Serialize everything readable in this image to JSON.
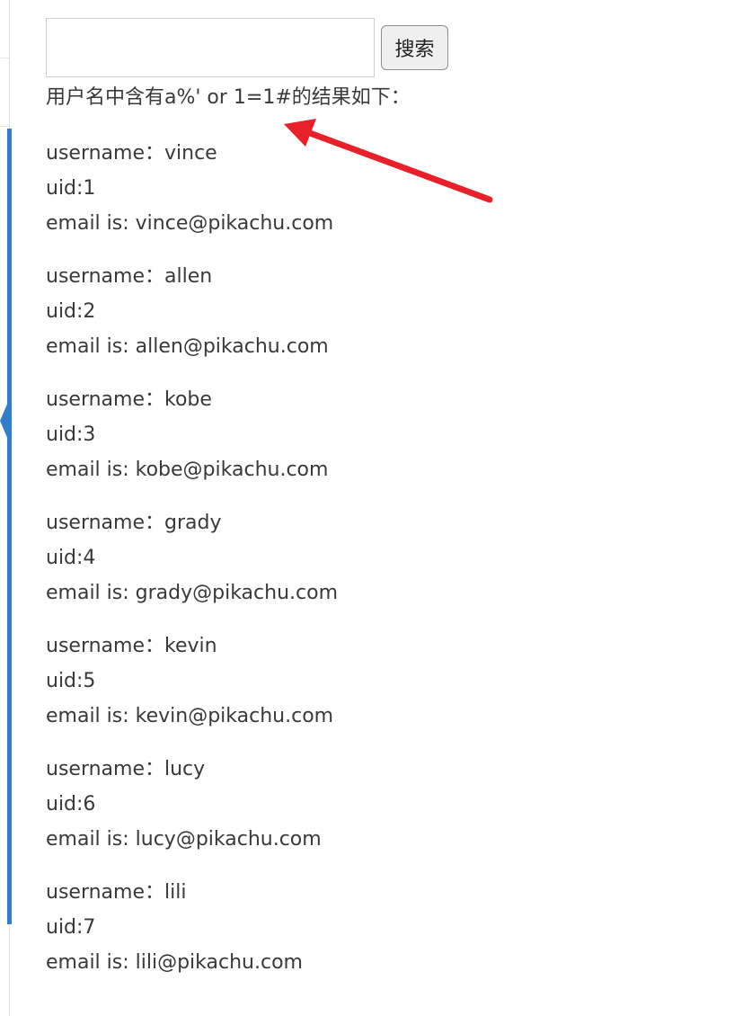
{
  "search": {
    "input_value": "",
    "button_label": "搜索"
  },
  "query": {
    "text": "用户名中含有a%' or 1=1#的结果如下："
  },
  "records": [
    {
      "username": "username：vince",
      "uid": "uid:1",
      "email": "email is: vince@pikachu.com"
    },
    {
      "username": "username：allen",
      "uid": "uid:2",
      "email": "email is: allen@pikachu.com"
    },
    {
      "username": "username：kobe",
      "uid": "uid:3",
      "email": "email is: kobe@pikachu.com"
    },
    {
      "username": "username：grady",
      "uid": "uid:4",
      "email": "email is: grady@pikachu.com"
    },
    {
      "username": "username：kevin",
      "uid": "uid:5",
      "email": "email is: kevin@pikachu.com"
    },
    {
      "username": "username：lucy",
      "uid": "uid:6",
      "email": "email is: lucy@pikachu.com"
    },
    {
      "username": "username：lili",
      "uid": "uid:7",
      "email": "email is: lili@pikachu.com"
    }
  ],
  "colors": {
    "accent_bar": "#307ecc",
    "annotation_arrow": "#e8202a",
    "text": "#393939"
  },
  "icons": {
    "annotation": "red-arrow-icon"
  }
}
